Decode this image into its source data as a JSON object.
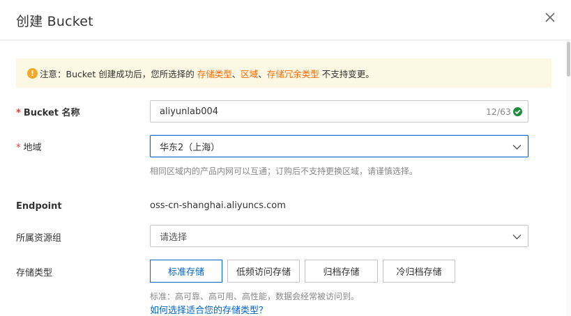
{
  "dialog": {
    "title": "创建 Bucket"
  },
  "notice": {
    "icon": "warning-icon",
    "prefix": "注意：Bucket 创建成功后，您所选择的 ",
    "link1": "存储类型",
    "sep1": "、",
    "link2": "区域",
    "sep2": "、",
    "link3": "存储冗余类型",
    "suffix": " 不支持变更。"
  },
  "form": {
    "bucket_name": {
      "required_mark": "*",
      "label": "Bucket 名称",
      "value": "aliyunlab004",
      "counter": "12/63",
      "status_icon": "check-circle-icon"
    },
    "region": {
      "required_mark": "*",
      "label": "地域",
      "value": "华东2（上海）",
      "hint": "相同区域内的产品内网可以互通；订购后不支持更换区域，请谨慎选择。"
    },
    "endpoint": {
      "label": "Endpoint",
      "value": "oss-cn-shanghai.aliyuncs.com"
    },
    "resource_group": {
      "label": "所属资源组",
      "placeholder": "请选择"
    },
    "storage_class": {
      "label": "存储类型",
      "options": [
        "标准存储",
        "低频访问存储",
        "归档存储",
        "冷归档存储"
      ],
      "selected_index": 0,
      "hint": "标准：高可靠、高可用、高性能，数据会经常被访问到。",
      "help_link": "如何选择适合您的存储类型？"
    }
  },
  "colors": {
    "accent": "#0064c8",
    "warning": "#f5a623",
    "notice_link": "#ff6a00",
    "required": "#e23c39",
    "success": "#1e8e3e"
  }
}
